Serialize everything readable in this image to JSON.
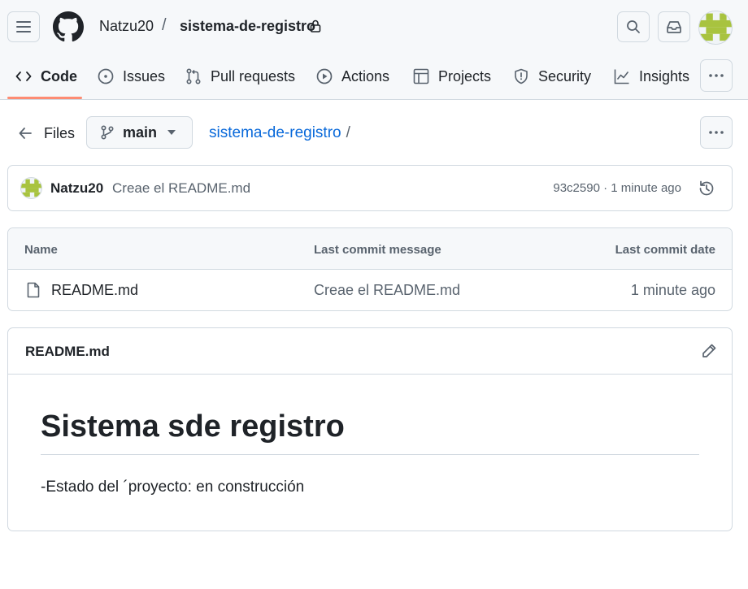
{
  "header": {
    "owner": "Natzu20",
    "separator": "/",
    "repo": "sistema-de-registro"
  },
  "tabs": [
    {
      "label": "Code",
      "icon": "code-icon",
      "active": true
    },
    {
      "label": "Issues",
      "icon": "issue-opened-icon"
    },
    {
      "label": "Pull requests",
      "icon": "git-pull-request-icon"
    },
    {
      "label": "Actions",
      "icon": "play-icon"
    },
    {
      "label": "Projects",
      "icon": "table-icon"
    },
    {
      "label": "Security",
      "icon": "shield-icon"
    },
    {
      "label": "Insights",
      "icon": "graph-icon"
    }
  ],
  "files_bar": {
    "files_label": "Files",
    "branch": "main",
    "breadcrumb_repo": "sistema-de-registro",
    "breadcrumb_sep": "/"
  },
  "commit": {
    "author": "Natzu20",
    "message": "Creae el README.md",
    "meta": "93c2590 · 1 minute ago"
  },
  "file_table": {
    "columns": [
      "Name",
      "Last commit message",
      "Last commit date"
    ],
    "rows": [
      {
        "name": "README.md",
        "message": "Creae el README.md",
        "date": "1 minute ago"
      }
    ]
  },
  "readme": {
    "title": "README.md",
    "heading": "Sistema sde registro",
    "paragraph": "-Estado del ´proyecto: en construcción"
  },
  "colors": {
    "accent_link": "#0969da",
    "tab_underline": "#fd8c73",
    "avatar_green": "#a8c33f"
  }
}
